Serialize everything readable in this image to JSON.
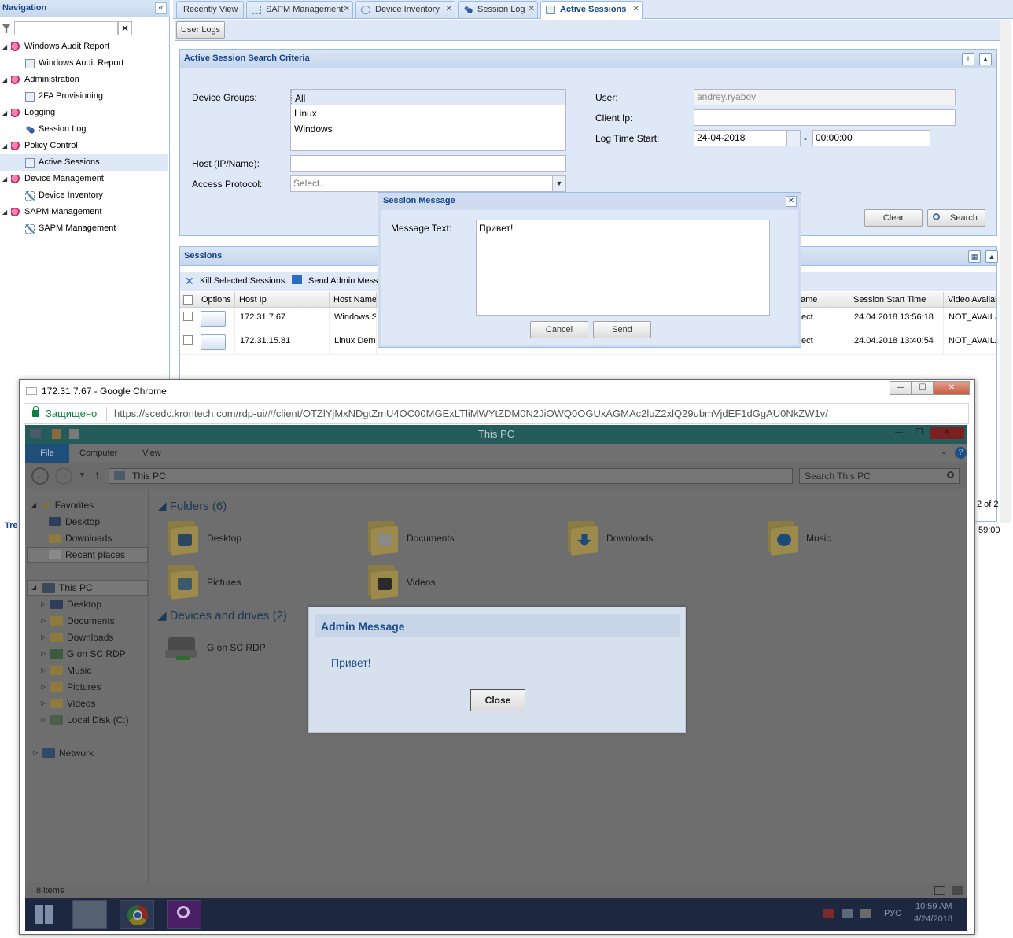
{
  "nav": {
    "title": "Navigation",
    "collapse_icon": "«",
    "filter_clear": "✕",
    "items": [
      {
        "label": "Windows Audit Report",
        "level": 0
      },
      {
        "label": "Windows Audit Report",
        "level": 1
      },
      {
        "label": "Administration",
        "level": 0
      },
      {
        "label": "2FA Provisioning",
        "level": 1
      },
      {
        "label": "Logging",
        "level": 0
      },
      {
        "label": "Session Log",
        "level": 1
      },
      {
        "label": "Policy Control",
        "level": 0
      },
      {
        "label": "Active Sessions",
        "level": 1,
        "selected": true
      },
      {
        "label": "Device Management",
        "level": 0
      },
      {
        "label": "Device Inventory",
        "level": 1
      },
      {
        "label": "SAPM Management",
        "level": 0
      },
      {
        "label": "SAPM Management",
        "level": 1
      }
    ],
    "bottom_cut_label": "Tre"
  },
  "tabs": [
    {
      "label": "Recently View",
      "closable": false
    },
    {
      "label": "SAPM Management",
      "closable": true
    },
    {
      "label": "Device Inventory",
      "closable": true
    },
    {
      "label": "Session Log",
      "closable": true
    },
    {
      "label": "Active Sessions",
      "closable": true,
      "active": true
    }
  ],
  "tab_close": "✕",
  "toolbar": {
    "user_logs": "User Logs"
  },
  "criteria": {
    "title": "Active Session Search Criteria",
    "device_groups_label": "Device Groups:",
    "device_groups": [
      "All",
      "Linux",
      "Windows"
    ],
    "host_label": "Host (IP/Name):",
    "host_value": "",
    "protocol_label": "Access Protocol:",
    "protocol_placeholder": "Select..",
    "user_label": "User:",
    "user_value": "andrey.ryabov",
    "client_ip_label": "Client Ip:",
    "client_ip_value": "",
    "log_time_label": "Log Time Start:",
    "log_date": "24-04-2018",
    "log_dash": "-",
    "log_time": "00:00:00",
    "clear_btn": "Clear",
    "search_btn": "Search"
  },
  "sessions": {
    "title": "Sessions",
    "kill_btn": "Kill Selected Sessions",
    "send_btn": "Send Admin Mess",
    "columns": [
      "Options",
      "Host Ip",
      "Host Name",
      "ame",
      "Session Start Time",
      "Video Availab"
    ],
    "rows": [
      {
        "host_ip": "172.31.7.67",
        "host_name": "Windows S",
        "name_cut": "ect",
        "start": "24.04.2018 13:56:18",
        "video": "NOT_AVAILA"
      },
      {
        "host_ip": "172.31.15.81",
        "host_name": "Linux Demo",
        "name_cut": "ect",
        "start": "24.04.2018 13:40:54",
        "video": "NOT_AVAILA"
      }
    ],
    "pager_cut": "2 of 2",
    "time_cut": "59:00"
  },
  "session_message": {
    "title": "Session Message",
    "close_icon": "✕",
    "label": "Message Text:",
    "text": "Привет!",
    "cancel": "Cancel",
    "send": "Send"
  },
  "chrome": {
    "title": "172.31.7.67 - Google Chrome",
    "secure": "Защищено",
    "url": "https://scedc.krontech.com/rdp-ui/#/client/OTZlYjMxNDgtZmU4OC00MGExLTliMWYtZDM0N2JiOWQ0OGUxAGMAc2luZ2xlQ29ubmVjdEF1dGgAU0NkZW1v/",
    "min": "—",
    "max": "☐",
    "close": "✕"
  },
  "explorer": {
    "title": "This PC",
    "ribbon_file": "File",
    "ribbon_tabs": [
      "Computer",
      "View"
    ],
    "path": "This PC",
    "search_placeholder": "Search This PC",
    "tree": {
      "favorites": "Favorites",
      "fav_items": [
        "Desktop",
        "Downloads",
        "Recent places"
      ],
      "this_pc": "This PC",
      "pc_items": [
        "Desktop",
        "Documents",
        "Downloads",
        "G on SC RDP",
        "Music",
        "Pictures",
        "Videos",
        "Local Disk (C:)"
      ],
      "network": "Network"
    },
    "folders_header": "Folders (6)",
    "folders": [
      "Desktop",
      "Documents",
      "Downloads",
      "Music",
      "Pictures",
      "Videos"
    ],
    "devices_header": "Devices and drives (2)",
    "devices": [
      "G on SC RDP"
    ],
    "status": "8 items",
    "tray_lang": "РУС",
    "clock_time": "10:59 AM",
    "clock_date": "4/24/2018"
  },
  "admin_message": {
    "title": "Admin Message",
    "text": "Привет!",
    "close": "Close"
  }
}
